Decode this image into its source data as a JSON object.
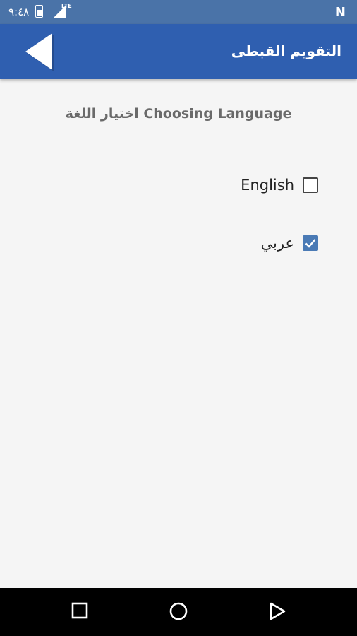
{
  "status_bar": {
    "time": "٩:٤٨",
    "network": "LTE",
    "notification_icon": "N"
  },
  "app_bar": {
    "title": "التقويم القبطى",
    "back_icon": "back-triangle"
  },
  "page": {
    "title": "اختيار اللغة Choosing Language"
  },
  "languages": [
    {
      "label": "English",
      "checked": false
    },
    {
      "label": "عربي",
      "checked": true
    }
  ],
  "colors": {
    "status_bar": "#4a73a8",
    "app_bar": "#2f5fb0",
    "checkbox_checked": "#4a7ab5",
    "background": "#f5f5f5"
  },
  "nav_bar": {
    "icons": [
      "square-recents-icon",
      "circle-home-icon",
      "triangle-back-icon"
    ]
  }
}
